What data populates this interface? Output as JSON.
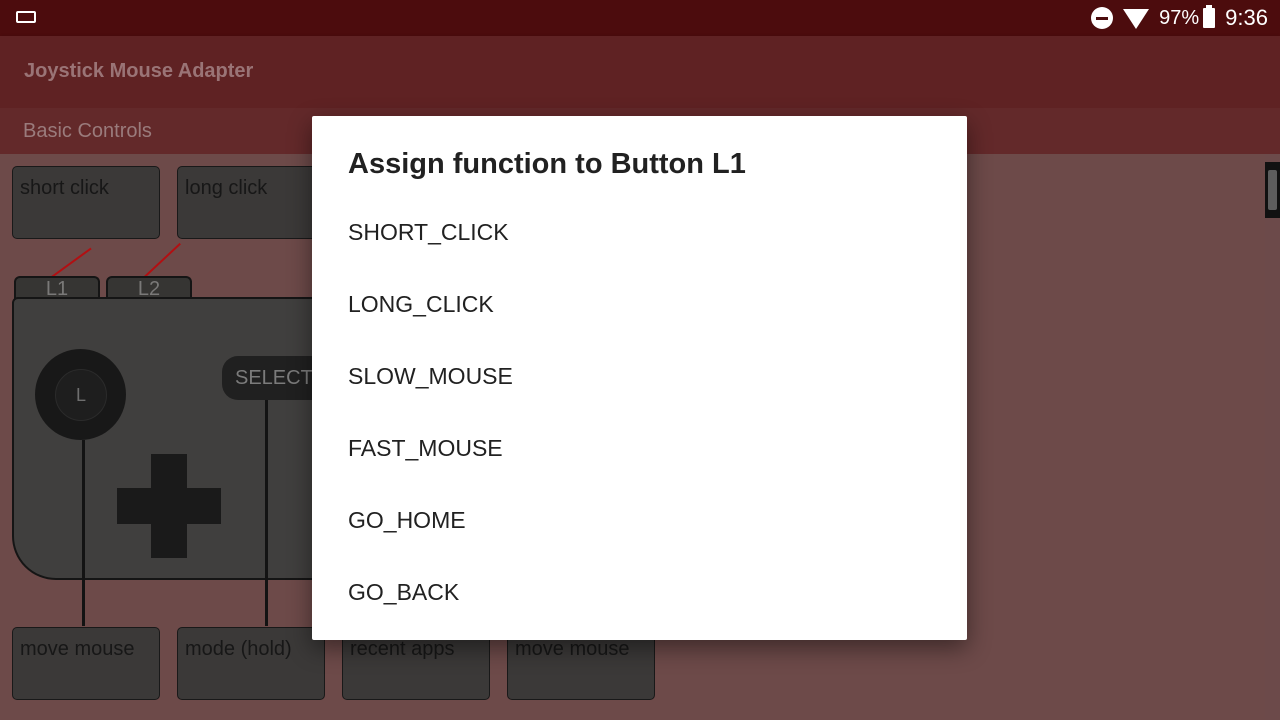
{
  "status_bar": {
    "left_icon": "screen-cast-icon",
    "battery_percent": "97%",
    "time": "9:36",
    "icons": [
      "do-not-disturb-icon",
      "wifi-icon",
      "battery-charging-icon"
    ]
  },
  "app_bar": {
    "title": "Joystick Mouse Adapter"
  },
  "tab": {
    "label": "Basic Controls"
  },
  "mapping": {
    "top_buttons": [
      "short click",
      "long click"
    ],
    "bottom_buttons": [
      "move mouse",
      "mode (hold)",
      "recent apps",
      "move mouse"
    ]
  },
  "gamepad": {
    "shoulder_left": "L1",
    "shoulder_right": "L2",
    "stick_label": "L",
    "select_label": "SELECT"
  },
  "dialog": {
    "title": "Assign function to Button L1",
    "options": [
      "SHORT_CLICK",
      "LONG_CLICK",
      "SLOW_MOUSE",
      "FAST_MOUSE",
      "GO_HOME",
      "GO_BACK"
    ]
  },
  "colors": {
    "status_bar": "#4c0c0d",
    "app_bar": "#5f2223",
    "content_bg": "#6d4a49",
    "connector_line": "#b20f12"
  }
}
